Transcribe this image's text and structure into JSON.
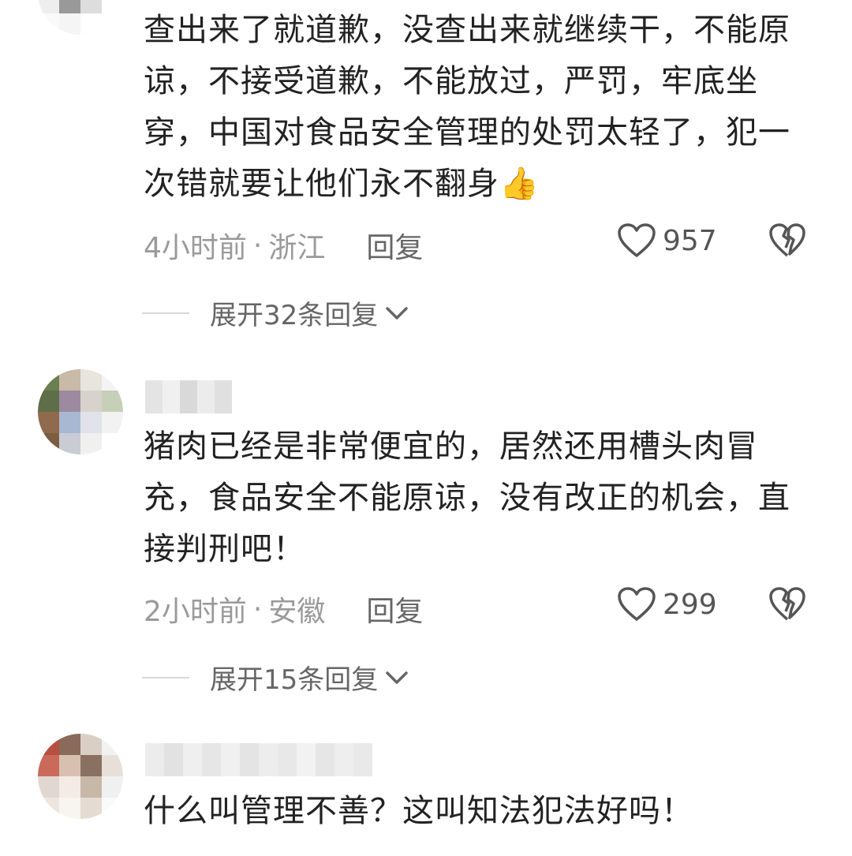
{
  "comments": [
    {
      "text": "查出来了就道歉，没查出来就继续干，不能原谅，不接受道歉，不能放过，严罚，牢底坐穿，中国对食品安全管理的处罚太轻了，犯一次错就要让他们永不翻身👍",
      "time": "4小时前",
      "region": "浙江",
      "reply_label": "回复",
      "likes": "957",
      "expand_label": "展开32条回复"
    },
    {
      "text": "猪肉已经是非常便宜的，居然还用槽头肉冒充，食品安全不能原谅，没有改正的机会，直接判刑吧！",
      "time": "2小时前",
      "region": "安徽",
      "reply_label": "回复",
      "likes": "299",
      "expand_label": "展开15条回复"
    },
    {
      "text": "什么叫管理不善？这叫知法犯法好吗！"
    }
  ],
  "separator": "·",
  "icons": {
    "like": "heart-outline-icon",
    "dislike": "broken-heart-icon",
    "expand": "chevron-down-icon"
  },
  "colors": {
    "text": "#222222",
    "meta": "#9a9a9a",
    "accent_icon": "#555555"
  }
}
